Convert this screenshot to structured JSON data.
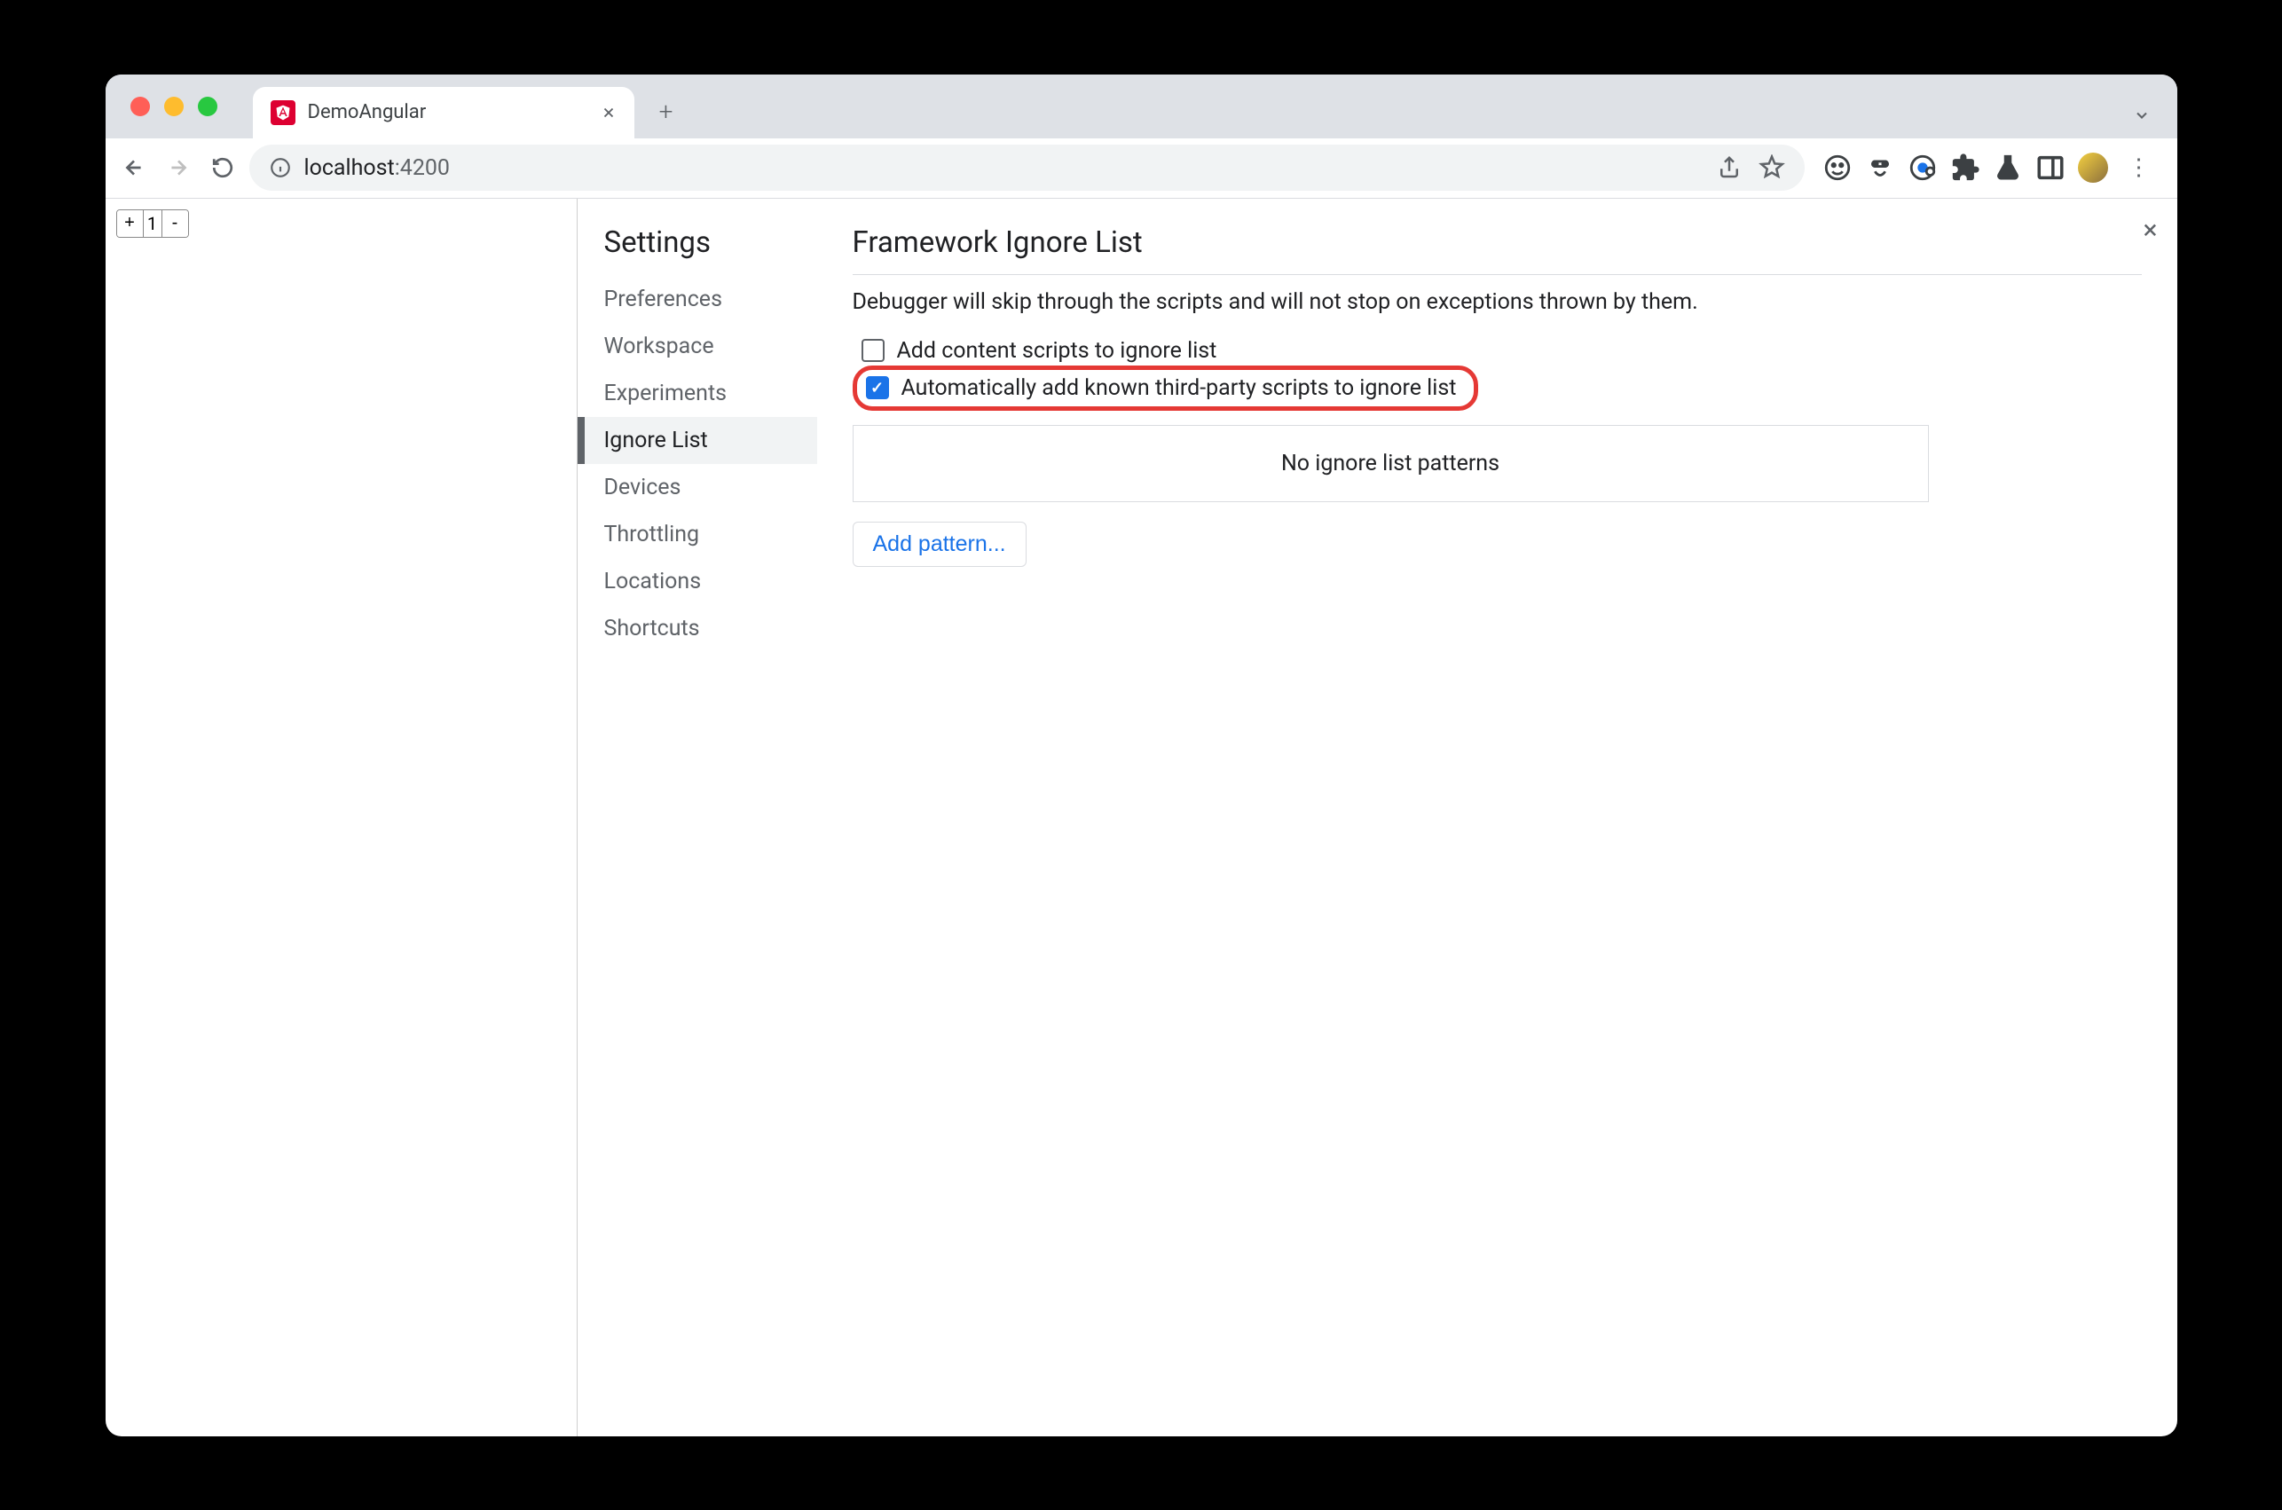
{
  "browser": {
    "tab_title": "DemoAngular",
    "address_host": "localhost",
    "address_port": ":4200"
  },
  "page": {
    "counter_value": "1",
    "plus": "+",
    "minus": "-"
  },
  "settings": {
    "title": "Settings",
    "nav": [
      "Preferences",
      "Workspace",
      "Experiments",
      "Ignore List",
      "Devices",
      "Throttling",
      "Locations",
      "Shortcuts"
    ],
    "active_index": 3
  },
  "main": {
    "title": "Framework Ignore List",
    "description": "Debugger will skip through the scripts and will not stop on exceptions thrown by them.",
    "checkbox1_label": "Add content scripts to ignore list",
    "checkbox1_checked": false,
    "checkbox2_label": "Automatically add known third-party scripts to ignore list",
    "checkbox2_checked": true,
    "patterns_empty": "No ignore list patterns",
    "add_pattern_label": "Add pattern..."
  }
}
